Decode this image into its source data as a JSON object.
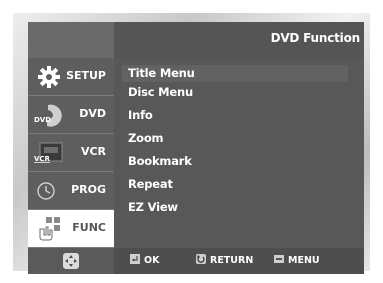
{
  "header": {
    "title": "DVD Function"
  },
  "sidebar": {
    "tabs": [
      {
        "label": "SETUP",
        "icon": "gear-icon",
        "selected": false
      },
      {
        "label": "DVD",
        "icon": "disc-icon",
        "icon_text": "DVD",
        "selected": false
      },
      {
        "label": "VCR",
        "icon": "cassette-icon",
        "icon_text": "VCR",
        "selected": false
      },
      {
        "label": "PROG",
        "icon": "clock-icon",
        "selected": false
      },
      {
        "label": "FUNC",
        "icon": "function-icon",
        "selected": true
      }
    ]
  },
  "menu": {
    "items": [
      {
        "label": "Title Menu",
        "highlighted": true
      },
      {
        "label": "Disc Menu"
      },
      {
        "label": "Info"
      },
      {
        "label": "Zoom"
      },
      {
        "label": "Bookmark"
      },
      {
        "label": "Repeat"
      },
      {
        "label": "EZ View"
      }
    ]
  },
  "footer": {
    "nav_icon": "four-way-arrow-icon",
    "ok_label": "OK",
    "return_label": "RETURN",
    "menu_label": "MENU"
  },
  "colors": {
    "panel": "#5a5a5a",
    "selected_tab": "#ffffff",
    "text": "#ffffff"
  }
}
